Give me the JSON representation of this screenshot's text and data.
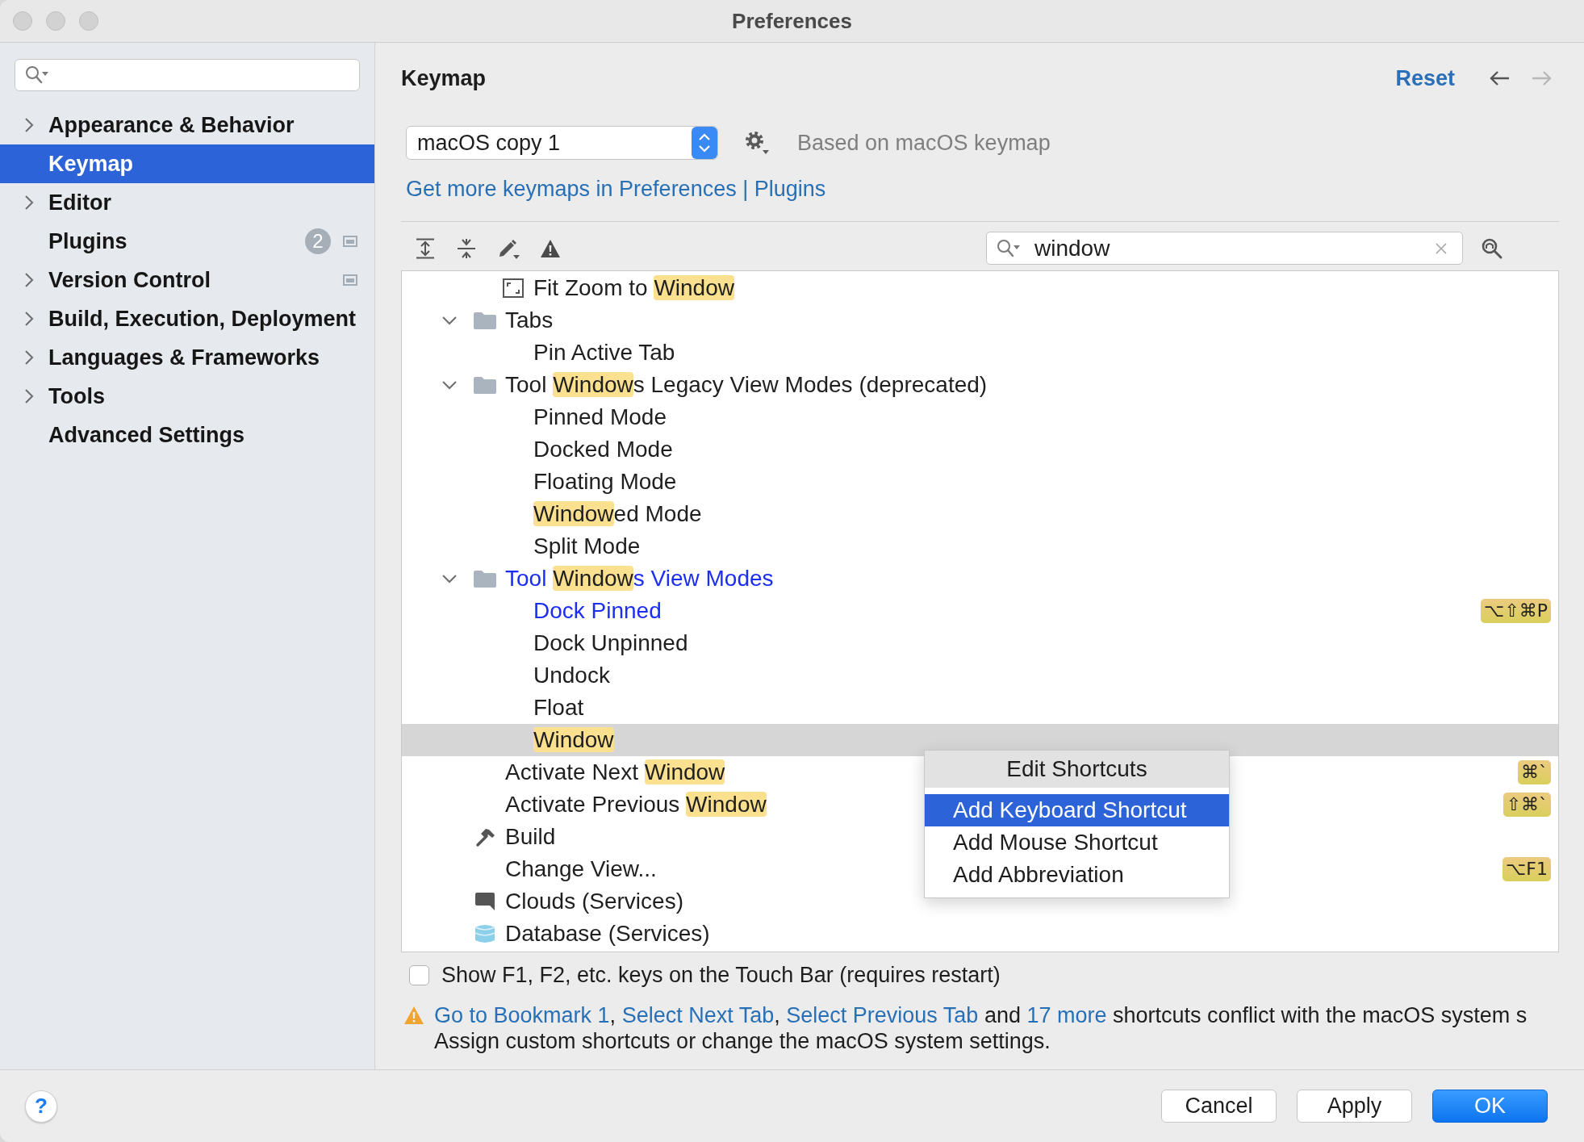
{
  "window": {
    "title": "Preferences"
  },
  "sidebar": {
    "items": [
      {
        "label": "Appearance & Behavior",
        "expandable": true,
        "selected": false,
        "project_level": false
      },
      {
        "label": "Keymap",
        "expandable": false,
        "selected": true,
        "project_level": false
      },
      {
        "label": "Editor",
        "expandable": true,
        "selected": false,
        "project_level": false
      },
      {
        "label": "Plugins",
        "expandable": false,
        "selected": false,
        "project_level": true,
        "badge": "2"
      },
      {
        "label": "Version Control",
        "expandable": true,
        "selected": false,
        "project_level": true
      },
      {
        "label": "Build, Execution, Deployment",
        "expandable": true,
        "selected": false,
        "project_level": false
      },
      {
        "label": "Languages & Frameworks",
        "expandable": true,
        "selected": false,
        "project_level": false
      },
      {
        "label": "Tools",
        "expandable": true,
        "selected": false,
        "project_level": false
      },
      {
        "label": "Advanced Settings",
        "expandable": false,
        "selected": false,
        "project_level": false
      }
    ]
  },
  "header": {
    "title": "Keymap",
    "reset": "Reset",
    "back": {
      "disabled": false
    },
    "forward": {
      "disabled": true
    }
  },
  "keymap": {
    "value": "macOS copy 1",
    "based_on": "Based on macOS keymap",
    "more_link": "Get more keymaps in Preferences | Plugins"
  },
  "filter": {
    "value": "window"
  },
  "tree": {
    "continued": [
      {
        "kind": "fit",
        "selected": false,
        "modified": false,
        "parts": [
          {
            "text": "Fit Zoom to ",
            "highlight": false
          },
          {
            "text": "Window",
            "highlight": true
          }
        ]
      }
    ],
    "items": [
      {
        "kind": "group",
        "expanded": true,
        "selected": false,
        "modified": false,
        "parts": [
          {
            "text": "Tabs",
            "highlight": false
          }
        ],
        "children": [
          {
            "kind": "action",
            "selected": false,
            "modified": false,
            "parts": [
              {
                "text": "Pin Active Tab",
                "highlight": false
              }
            ]
          }
        ]
      },
      {
        "kind": "group",
        "expanded": true,
        "selected": false,
        "modified": false,
        "parts": [
          {
            "text": "Tool ",
            "highlight": false
          },
          {
            "text": "Window",
            "highlight": true
          },
          {
            "text": "s Legacy View Modes (deprecated)",
            "highlight": false
          }
        ],
        "children": [
          {
            "kind": "action",
            "selected": false,
            "modified": false,
            "parts": [
              {
                "text": "Pinned Mode",
                "highlight": false
              }
            ]
          },
          {
            "kind": "action",
            "selected": false,
            "modified": false,
            "parts": [
              {
                "text": "Docked Mode",
                "highlight": false
              }
            ]
          },
          {
            "kind": "action",
            "selected": false,
            "modified": false,
            "parts": [
              {
                "text": "Floating Mode",
                "highlight": false
              }
            ]
          },
          {
            "kind": "action",
            "selected": false,
            "modified": false,
            "parts": [
              {
                "text": "Window",
                "highlight": true
              },
              {
                "text": "ed Mode",
                "highlight": false
              }
            ]
          },
          {
            "kind": "action",
            "selected": false,
            "modified": false,
            "parts": [
              {
                "text": "Split Mode",
                "highlight": false
              }
            ]
          }
        ]
      },
      {
        "kind": "group",
        "expanded": true,
        "selected": false,
        "modified": true,
        "parts": [
          {
            "text": "Tool ",
            "highlight": false
          },
          {
            "text": "Window",
            "highlight": true
          },
          {
            "text": "s View Modes",
            "highlight": false
          }
        ],
        "children": [
          {
            "kind": "action",
            "selected": false,
            "modified": true,
            "shortcut": "⌥⇧⌘P",
            "parts": [
              {
                "text": "Dock Pinned",
                "highlight": false
              }
            ]
          },
          {
            "kind": "action",
            "selected": false,
            "modified": false,
            "parts": [
              {
                "text": "Dock Unpinned",
                "highlight": false
              }
            ]
          },
          {
            "kind": "action",
            "selected": false,
            "modified": false,
            "parts": [
              {
                "text": "Undock",
                "highlight": false
              }
            ]
          },
          {
            "kind": "action",
            "selected": false,
            "modified": false,
            "parts": [
              {
                "text": "Float",
                "highlight": false
              }
            ]
          },
          {
            "kind": "action",
            "selected": true,
            "modified": false,
            "parts": [
              {
                "text": "Window",
                "highlight": true
              }
            ]
          }
        ]
      },
      {
        "kind": "action",
        "selected": false,
        "modified": false,
        "shortcut": "⌘`",
        "parts": [
          {
            "text": "Activate Next ",
            "highlight": false
          },
          {
            "text": "Window",
            "highlight": true
          }
        ]
      },
      {
        "kind": "action",
        "selected": false,
        "modified": false,
        "shortcut": "⇧⌘`",
        "parts": [
          {
            "text": "Activate Previous ",
            "highlight": false
          },
          {
            "text": "Window",
            "highlight": true
          }
        ]
      },
      {
        "kind": "build",
        "selected": false,
        "modified": false,
        "parts": [
          {
            "text": "Build",
            "highlight": false
          }
        ]
      },
      {
        "kind": "action",
        "selected": false,
        "modified": false,
        "shortcut": "⌥F1",
        "parts": [
          {
            "text": "Change View...",
            "highlight": false
          }
        ]
      },
      {
        "kind": "clouds",
        "selected": false,
        "modified": false,
        "parts": [
          {
            "text": "Clouds (Services)",
            "highlight": false
          }
        ]
      },
      {
        "kind": "database",
        "selected": false,
        "modified": false,
        "parts": [
          {
            "text": "Database (Services)",
            "highlight": false
          }
        ]
      }
    ]
  },
  "context_menu": {
    "title": "Edit Shortcuts",
    "items": [
      {
        "label": "Add Keyboard Shortcut",
        "selected": true
      },
      {
        "label": "Add Mouse Shortcut",
        "selected": false
      },
      {
        "label": "Add Abbreviation",
        "selected": false
      }
    ]
  },
  "touch_bar_option": {
    "label": "Show F1, F2, etc. keys on the Touch Bar (requires restart)",
    "checked": false
  },
  "conflict_notice": {
    "parts": [
      {
        "text": "Go to Bookmark 1",
        "kind": "link"
      },
      {
        "text": ", ",
        "kind": "text"
      },
      {
        "text": "Select Next Tab",
        "kind": "link"
      },
      {
        "text": ", ",
        "kind": "text"
      },
      {
        "text": "Select Previous Tab",
        "kind": "link"
      },
      {
        "text": " and ",
        "kind": "text"
      },
      {
        "text": "17 more",
        "kind": "link"
      },
      {
        "text": " shortcuts conflict with the macOS system s",
        "kind": "text"
      }
    ],
    "second_line": "Assign custom shortcuts or change the macOS system settings."
  },
  "help": {
    "label": "?"
  },
  "buttons": [
    {
      "label": "Cancel",
      "default": false
    },
    {
      "label": "Apply",
      "default": false
    },
    {
      "label": "OK",
      "default": true
    }
  ]
}
